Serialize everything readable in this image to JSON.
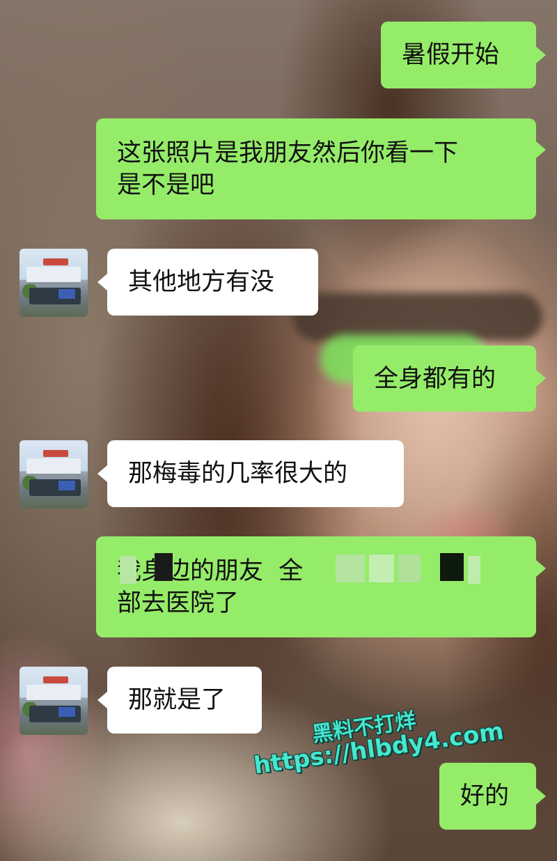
{
  "messages": [
    {
      "side": "out",
      "text": "暑假开始"
    },
    {
      "side": "out",
      "text": "这张照片是我朋友然后你看一下\n是不是吧"
    },
    {
      "side": "in",
      "text": "其他地方有没"
    },
    {
      "side": "out",
      "text": "全身都有的"
    },
    {
      "side": "in",
      "text": "那梅毒的几率很大的"
    },
    {
      "side": "out",
      "text": "我身边的朋友  全\n部去医院了"
    },
    {
      "side": "in",
      "text": "那就是了"
    },
    {
      "side": "out",
      "text": "好的"
    }
  ],
  "watermark": {
    "brand": "黑料不打烊",
    "url": "https://hlbdy4.com"
  },
  "colors": {
    "outgoing_bubble": "#95ec69",
    "incoming_bubble": "#ffffff",
    "watermark": "#46e6cf"
  },
  "icons": {
    "contact_avatar": "avatar-photo-building-bus"
  }
}
